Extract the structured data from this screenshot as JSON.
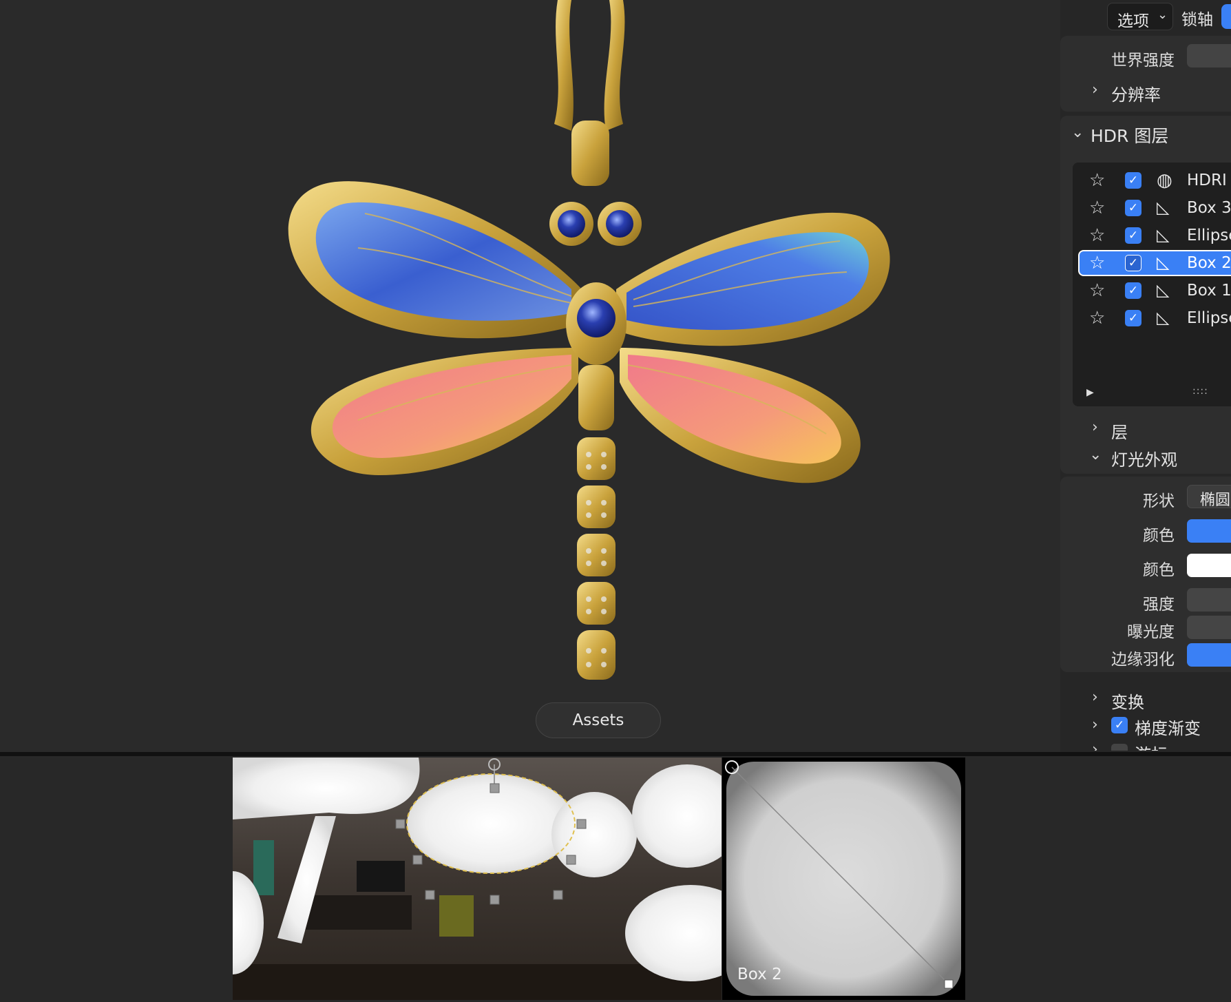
{
  "toolbar": {
    "options_label": "选项",
    "lock_axis_label": "锁轴"
  },
  "world": {
    "world_strength_label": "世界强度",
    "resolution_label": "分辨率"
  },
  "hdr_layers": {
    "section_title": "HDR 图层",
    "layers": [
      {
        "name": "HDRI",
        "type": "globe",
        "checked": true,
        "selected": false
      },
      {
        "name": "Box 3",
        "type": "light",
        "checked": true,
        "selected": false
      },
      {
        "name": "Ellipse",
        "type": "light",
        "checked": true,
        "selected": false
      },
      {
        "name": "Box 2",
        "type": "light",
        "checked": true,
        "selected": true
      },
      {
        "name": "Box 1",
        "type": "light",
        "checked": true,
        "selected": false
      },
      {
        "name": "Ellipse",
        "type": "light",
        "checked": true,
        "selected": false
      }
    ],
    "grip": "::::"
  },
  "sections": {
    "layer_label": "层",
    "light_appearance_label": "灯光外观",
    "transform_label": "变换",
    "gradient_label": "梯度渐变",
    "cursor_label": "游标"
  },
  "light_appearance": {
    "shape_label": "形状",
    "shape_value": "椭圆",
    "color1_label": "颜色",
    "color2_label": "颜色",
    "strength_label": "强度",
    "exposure_label": "曝光度",
    "feather_label": "边缘羽化",
    "color1_value": "#3a80f5",
    "color2_value": "#ffffff",
    "accent": "#3a80f5"
  },
  "viewport": {
    "assets_label": "Assets"
  },
  "previews": {
    "box_label": "Box 2"
  }
}
